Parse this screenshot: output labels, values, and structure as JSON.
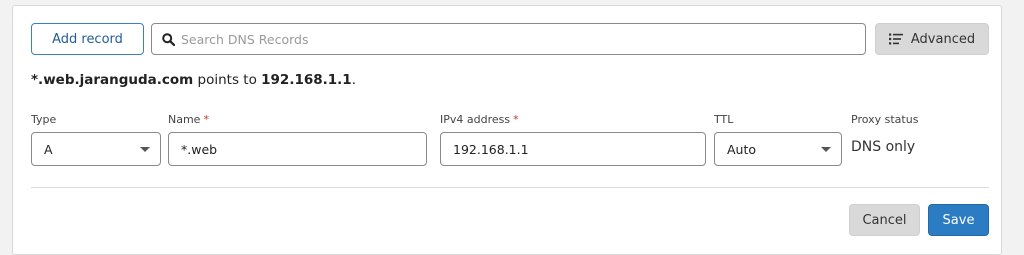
{
  "toolbar": {
    "add_record_label": "Add record",
    "search_placeholder": "Search DNS Records",
    "advanced_label": "Advanced"
  },
  "summary": {
    "name": "*.web.jaranguda.com",
    "middle": " points to ",
    "target": "192.168.1.1",
    "end": "."
  },
  "form": {
    "type_label": "Type",
    "type_value": "A",
    "name_label": "Name",
    "name_value": "*.web",
    "ipv4_label": "IPv4 address",
    "ipv4_value": "192.168.1.1",
    "ttl_label": "TTL",
    "ttl_value": "Auto",
    "proxy_label": "Proxy status",
    "proxy_value": "DNS only",
    "required_mark": "*"
  },
  "actions": {
    "cancel_label": "Cancel",
    "save_label": "Save"
  },
  "colors": {
    "primary": "#2c7cc4",
    "required": "#c0392b",
    "secondary_button": "#d9d9d9"
  }
}
